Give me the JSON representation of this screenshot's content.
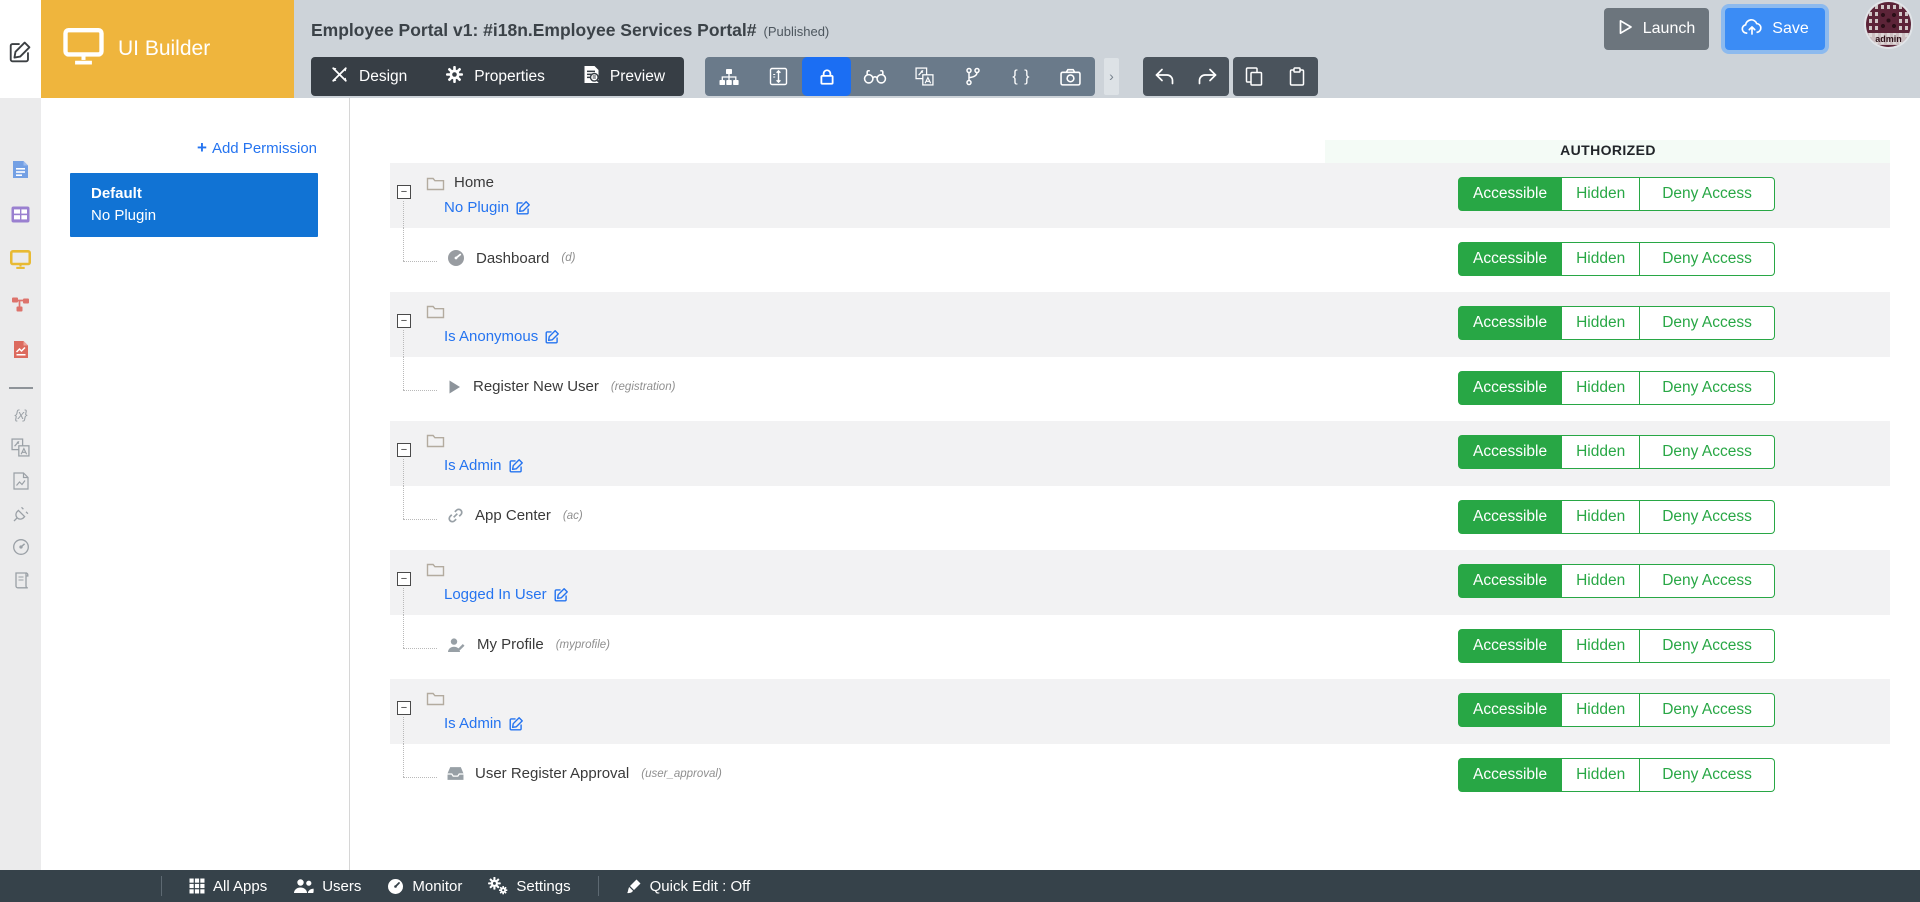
{
  "colors": {
    "brand_yellow": "#efb53d",
    "topbar_gray": "#cdd3d9",
    "accent_blue": "#2574f0",
    "active_tool_blue": "#1b6ef3",
    "selected_card_blue": "#1173d4",
    "success_green": "#28a745",
    "footer_dark": "#36424a",
    "row_gray": "#f2f2f3"
  },
  "topbar": {
    "app_name": "UI Builder",
    "title": "Employee Portal v1: #i18n.Employee Services Portal#",
    "status": "(Published)",
    "design_label": "Design",
    "properties_label": "Properties",
    "preview_label": "Preview",
    "tools": [
      "sitemap-icon",
      "screens-icon",
      "lock-icon",
      "binoculars-icon",
      "translate-icon",
      "branch-icon",
      "braces-icon",
      "camera-icon"
    ],
    "active_tool": "lock-icon",
    "launch_label": "Launch",
    "save_label": "Save",
    "avatar_label": "admin"
  },
  "rail": {
    "items": [
      "form-icon",
      "datalist-icon",
      "userview-icon",
      "process-icon",
      "report-icon",
      "divider",
      "variable-icon",
      "i18n-icon",
      "resources-icon",
      "plugin-icon",
      "performance-icon",
      "license-icon"
    ]
  },
  "left_panel": {
    "add_permission_plus": "+",
    "add_permission_label": "Add Permission",
    "permissions": [
      {
        "name": "Default",
        "plugin": "No Plugin",
        "selected": true
      }
    ]
  },
  "authorized": {
    "header": "AUTHORIZED",
    "options": [
      "Accessible",
      "Hidden",
      "Deny Access"
    ],
    "selected": "Accessible"
  },
  "tree": {
    "sections": [
      {
        "title": "Home",
        "permission": "No Plugin",
        "access": "Accessible",
        "children": [
          {
            "icon": "dashboard-icon",
            "label": "Dashboard",
            "code": "(d)",
            "access": "Accessible"
          }
        ]
      },
      {
        "title": "",
        "permission": "Is Anonymous",
        "access": "Accessible",
        "children": [
          {
            "icon": "play-icon",
            "label": "Register New User",
            "code": "(registration)",
            "access": "Accessible"
          }
        ]
      },
      {
        "title": "",
        "permission": "Is Admin",
        "access": "Accessible",
        "children": [
          {
            "icon": "link-icon",
            "label": "App Center",
            "code": "(ac)",
            "access": "Accessible"
          }
        ]
      },
      {
        "title": "",
        "permission": "Logged In User",
        "access": "Accessible",
        "children": [
          {
            "icon": "user-edit-icon",
            "label": "My Profile",
            "code": "(myprofile)",
            "access": "Accessible"
          }
        ]
      },
      {
        "title": "",
        "permission": "Is Admin",
        "access": "Accessible",
        "children": [
          {
            "icon": "inbox-icon",
            "label": "User Register Approval",
            "code": "(user_approval)",
            "access": "Accessible"
          }
        ]
      }
    ]
  },
  "footer": {
    "items": [
      {
        "icon": "grid-icon",
        "label": "All Apps",
        "divider_before": true
      },
      {
        "icon": "users-icon",
        "label": "Users"
      },
      {
        "icon": "monitor-icon",
        "label": "Monitor"
      },
      {
        "icon": "settings-icon",
        "label": "Settings"
      },
      {
        "icon": "brush-icon",
        "label": "Quick Edit : Off",
        "divider_before": true
      }
    ]
  }
}
